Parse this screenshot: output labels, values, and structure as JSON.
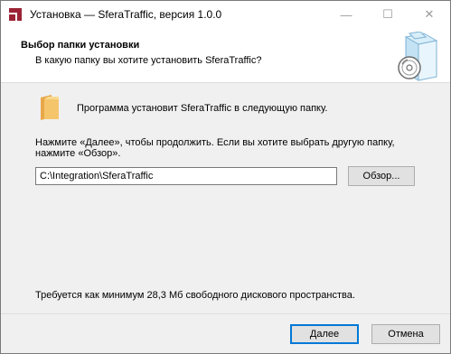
{
  "window": {
    "title": "Установка — SferaTraffic, версия 1.0.0",
    "minimize_glyph": "—",
    "maximize_glyph": "☐",
    "close_glyph": "✕"
  },
  "header": {
    "title": "Выбор папки установки",
    "subtitle": "В какую папку вы хотите установить SferaTraffic?",
    "logo_icon": "installer-box-disc-icon"
  },
  "content": {
    "folder_icon": "folder-icon",
    "intro": "Программа установит SferaTraffic в следующую папку.",
    "hint_line1": "Нажмите «Далее», чтобы продолжить. Если вы хотите выбрать другую папку,",
    "hint_line2": "нажмите «Обзор».",
    "path_value": "C:\\Integration\\SferaTraffic",
    "browse_label": "Обзор...",
    "space_required": "Требуется как минимум 28,3 Мб свободного дискового пространства."
  },
  "footer": {
    "next_label": "Далее",
    "cancel_label": "Отмена"
  },
  "colors": {
    "accent": "#0078d7",
    "app_icon": "#9b2335"
  }
}
